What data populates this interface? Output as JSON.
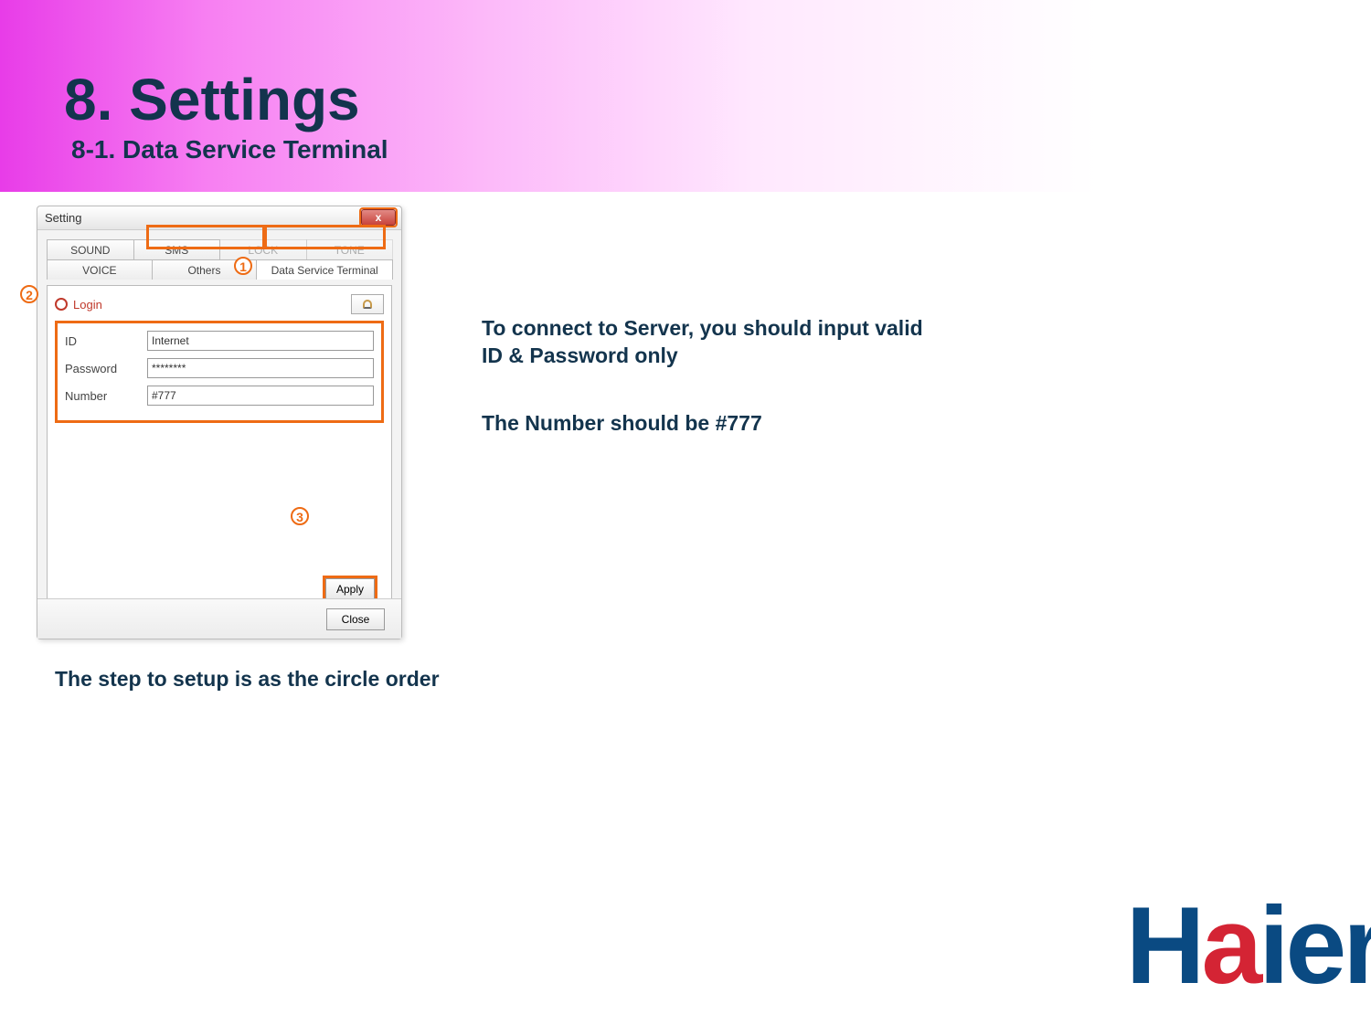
{
  "page": {
    "title": "8. Settings",
    "subtitle": "8-1. Data Service Terminal",
    "caption": "The step to setup is as the circle order"
  },
  "notes": {
    "line1": "To connect to Server, you should input valid ID & Password only",
    "line2": "The Number should be #777"
  },
  "window": {
    "title": "Setting",
    "close_x": "x",
    "tabs": {
      "sound": "SOUND",
      "sms": "SMS",
      "lock": "LOCK",
      "tone": "TONE",
      "voice": "VOICE",
      "others": "Others",
      "dst": "Data Service Terminal"
    },
    "login": {
      "header": "Login",
      "id_label": "ID",
      "id_value": "Internet",
      "password_label": "Password",
      "password_value": "********",
      "number_label": "Number",
      "number_value": "#777"
    },
    "buttons": {
      "apply": "Apply",
      "close": "Close"
    }
  },
  "badges": {
    "b1": "1",
    "b2": "2",
    "b3": "3"
  },
  "logo": {
    "h": "H",
    "a": "a",
    "ier": "ier"
  }
}
